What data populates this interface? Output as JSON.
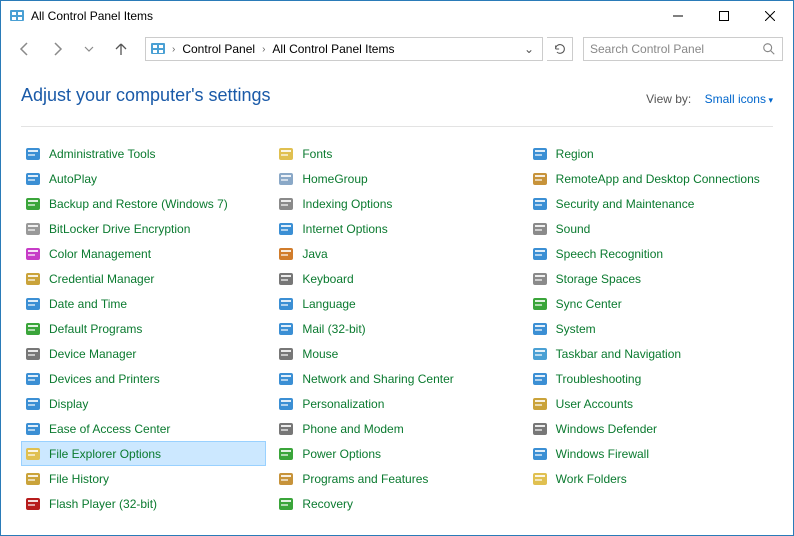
{
  "window": {
    "title": "All Control Panel Items"
  },
  "breadcrumb": {
    "root": "Control Panel",
    "leaf": "All Control Panel Items"
  },
  "search": {
    "placeholder": "Search Control Panel"
  },
  "header": {
    "heading": "Adjust your computer's settings",
    "viewby_label": "View by:",
    "viewby_value": "Small icons"
  },
  "items": [
    {
      "label": "Administrative Tools",
      "icon": "admin-tools",
      "c": "#3b8fd4"
    },
    {
      "label": "AutoPlay",
      "icon": "autoplay",
      "c": "#3b8fd4"
    },
    {
      "label": "Backup and Restore (Windows 7)",
      "icon": "backup",
      "c": "#3aa53a"
    },
    {
      "label": "BitLocker Drive Encryption",
      "icon": "bitlocker",
      "c": "#999999"
    },
    {
      "label": "Color Management",
      "icon": "color-mgmt",
      "c": "#c73cc7"
    },
    {
      "label": "Credential Manager",
      "icon": "credential",
      "c": "#caa33a"
    },
    {
      "label": "Date and Time",
      "icon": "date-time",
      "c": "#3b8fd4"
    },
    {
      "label": "Default Programs",
      "icon": "default-programs",
      "c": "#3aa53a"
    },
    {
      "label": "Device Manager",
      "icon": "device-manager",
      "c": "#777777"
    },
    {
      "label": "Devices and Printers",
      "icon": "devices-printers",
      "c": "#3b8fd4"
    },
    {
      "label": "Display",
      "icon": "display",
      "c": "#3b8fd4"
    },
    {
      "label": "Ease of Access Center",
      "icon": "ease-access",
      "c": "#3b8fd4"
    },
    {
      "label": "File Explorer Options",
      "icon": "file-explorer-options",
      "c": "#e0c050",
      "selected": true
    },
    {
      "label": "File History",
      "icon": "file-history",
      "c": "#caa33a"
    },
    {
      "label": "Flash Player (32-bit)",
      "icon": "flash",
      "c": "#b71c1c"
    },
    {
      "label": "Fonts",
      "icon": "fonts",
      "c": "#e0c050"
    },
    {
      "label": "HomeGroup",
      "icon": "homegroup",
      "c": "#8aa8c7"
    },
    {
      "label": "Indexing Options",
      "icon": "indexing",
      "c": "#8a8a8a"
    },
    {
      "label": "Internet Options",
      "icon": "internet-options",
      "c": "#3b8fd4"
    },
    {
      "label": "Java",
      "icon": "java",
      "c": "#d17c2b"
    },
    {
      "label": "Keyboard",
      "icon": "keyboard",
      "c": "#777777"
    },
    {
      "label": "Language",
      "icon": "language",
      "c": "#3b8fd4"
    },
    {
      "label": "Mail (32-bit)",
      "icon": "mail",
      "c": "#3b8fd4"
    },
    {
      "label": "Mouse",
      "icon": "mouse",
      "c": "#777777"
    },
    {
      "label": "Network and Sharing Center",
      "icon": "network-sharing",
      "c": "#3b8fd4"
    },
    {
      "label": "Personalization",
      "icon": "personalization",
      "c": "#3b8fd4"
    },
    {
      "label": "Phone and Modem",
      "icon": "phone-modem",
      "c": "#777777"
    },
    {
      "label": "Power Options",
      "icon": "power-options",
      "c": "#3aa53a"
    },
    {
      "label": "Programs and Features",
      "icon": "programs-features",
      "c": "#c7933a"
    },
    {
      "label": "Recovery",
      "icon": "recovery",
      "c": "#3aa53a"
    },
    {
      "label": "Region",
      "icon": "region",
      "c": "#3b8fd4"
    },
    {
      "label": "RemoteApp and Desktop Connections",
      "icon": "remoteapp",
      "c": "#c7933a"
    },
    {
      "label": "Security and Maintenance",
      "icon": "security-maintenance",
      "c": "#3b8fd4"
    },
    {
      "label": "Sound",
      "icon": "sound",
      "c": "#8a8a8a"
    },
    {
      "label": "Speech Recognition",
      "icon": "speech",
      "c": "#3b8fd4"
    },
    {
      "label": "Storage Spaces",
      "icon": "storage-spaces",
      "c": "#8a8a8a"
    },
    {
      "label": "Sync Center",
      "icon": "sync-center",
      "c": "#3aa53a"
    },
    {
      "label": "System",
      "icon": "system",
      "c": "#3b8fd4"
    },
    {
      "label": "Taskbar and Navigation",
      "icon": "taskbar-nav",
      "c": "#4aa0d4"
    },
    {
      "label": "Troubleshooting",
      "icon": "troubleshooting",
      "c": "#3b8fd4"
    },
    {
      "label": "User Accounts",
      "icon": "user-accounts",
      "c": "#caa33a"
    },
    {
      "label": "Windows Defender",
      "icon": "windows-defender",
      "c": "#777777"
    },
    {
      "label": "Windows Firewall",
      "icon": "windows-firewall",
      "c": "#3b8fd4"
    },
    {
      "label": "Work Folders",
      "icon": "work-folders",
      "c": "#e0c050"
    }
  ]
}
